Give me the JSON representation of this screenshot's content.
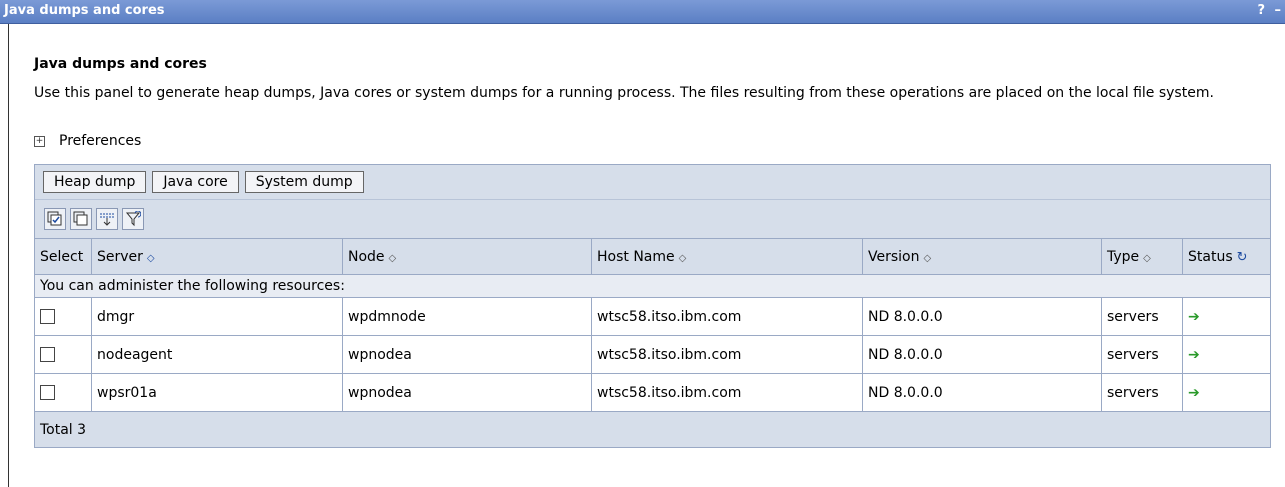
{
  "window": {
    "title": "Java dumps and cores",
    "help": "?",
    "minimize": "–"
  },
  "page": {
    "heading": "Java dumps and cores",
    "description": "Use this panel to generate heap dumps, Java cores or system dumps for a running process. The files resulting from these operations are placed on the local file system.",
    "preferences_label": "Preferences",
    "preferences_toggle": "+"
  },
  "toolbar": {
    "heap_dump": "Heap dump",
    "java_core": "Java core",
    "system_dump": "System dump"
  },
  "icons": [
    "select-all-icon",
    "deselect-all-icon",
    "show-filter-icon",
    "clear-filter-icon"
  ],
  "table": {
    "headers": {
      "select": "Select",
      "server": "Server",
      "node": "Node",
      "host": "Host Name",
      "version": "Version",
      "type": "Type",
      "status": "Status"
    },
    "sort_glyph": "◇",
    "active_sort_glyph": "◇",
    "refresh_glyph": "↻",
    "section_label": "You can administer the following resources:",
    "rows": [
      {
        "server": "dmgr",
        "node": "wpdmnode",
        "host": "wtsc58.itso.ibm.com",
        "version": "ND 8.0.0.0",
        "type": "servers",
        "status": "➔"
      },
      {
        "server": "nodeagent",
        "node": "wpnodea",
        "host": "wtsc58.itso.ibm.com",
        "version": "ND 8.0.0.0",
        "type": "servers",
        "status": "➔"
      },
      {
        "server": "wpsr01a",
        "node": "wpnodea",
        "host": "wtsc58.itso.ibm.com",
        "version": "ND 8.0.0.0",
        "type": "servers",
        "status": "➔"
      }
    ],
    "total": "Total 3"
  },
  "colors": {
    "title_bar": "#5b7fc4",
    "panel_bg": "#d6deea",
    "status_green": "#2a9a2a"
  }
}
